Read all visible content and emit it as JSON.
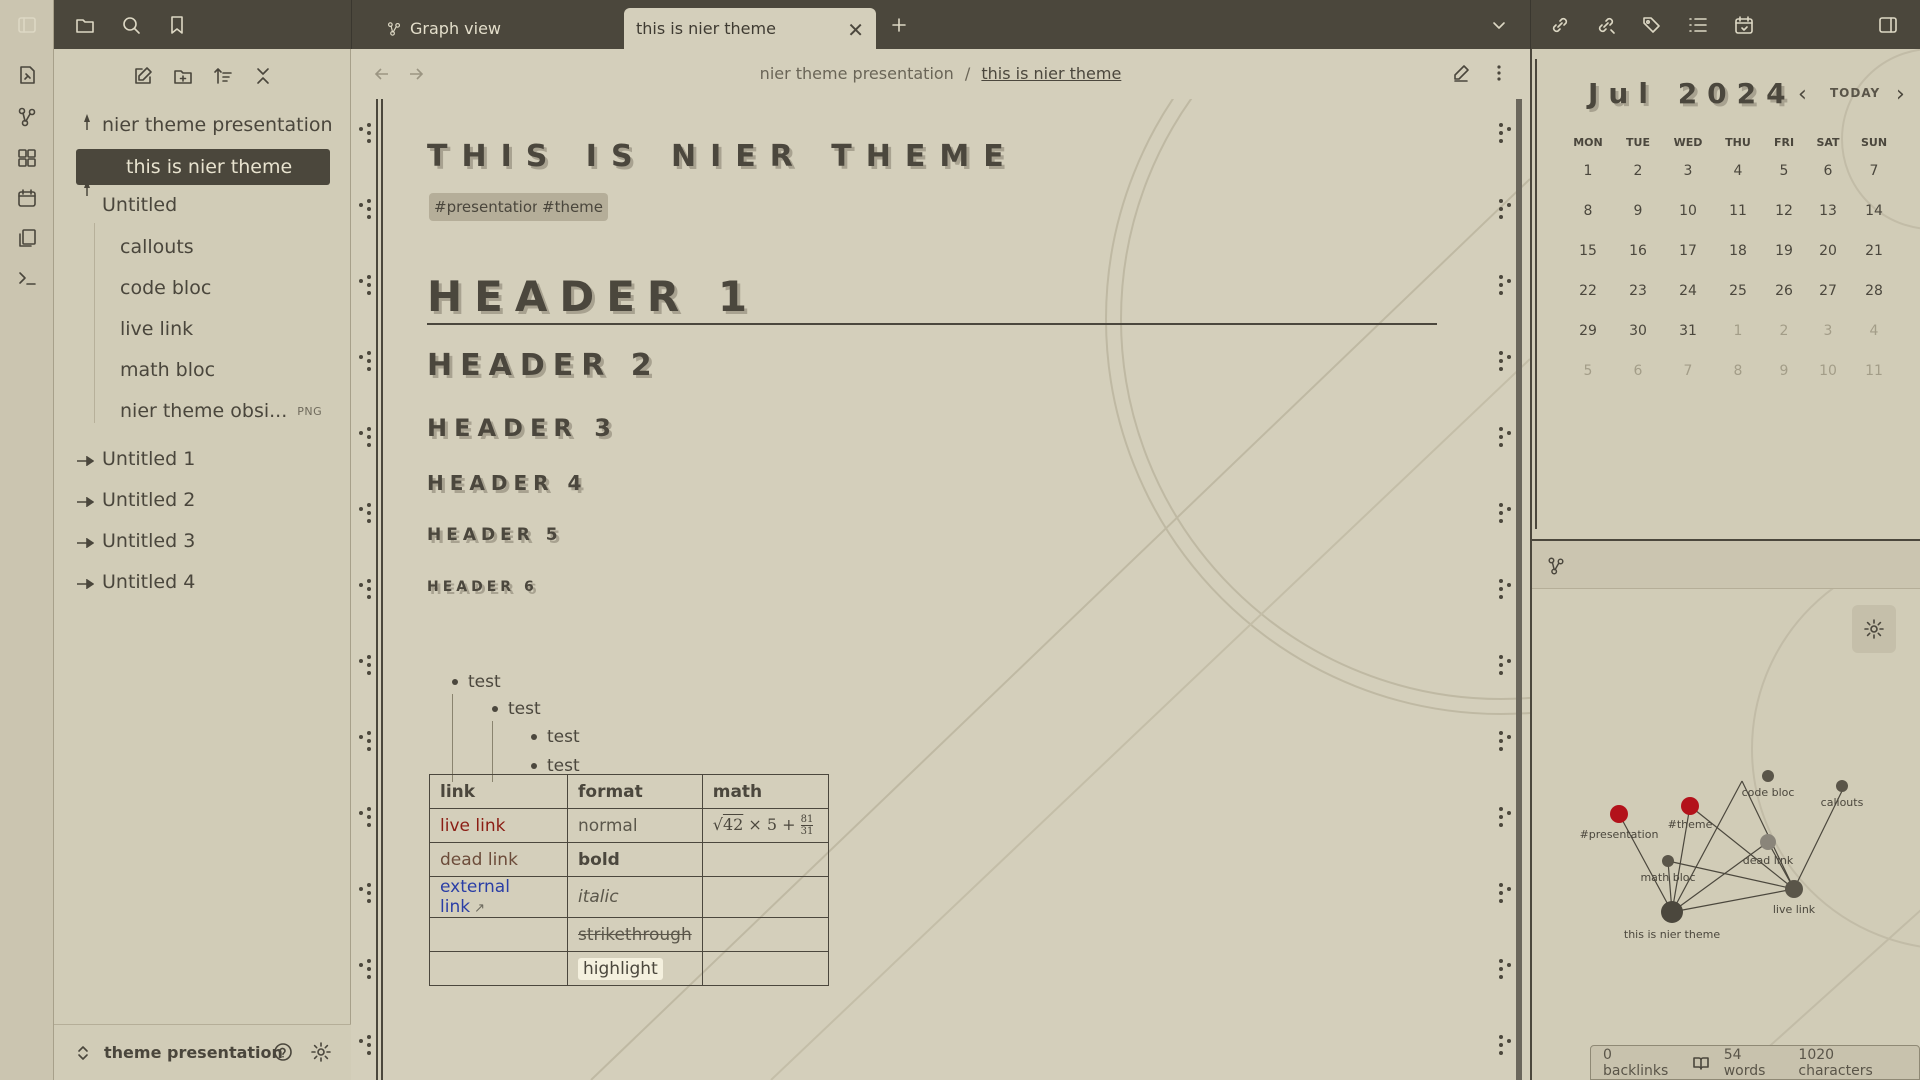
{
  "window": {
    "active_tab": "this is nier theme"
  },
  "tabs": [
    {
      "label": "Graph view"
    },
    {
      "label": "this is nier theme"
    }
  ],
  "breadcrumb": {
    "parent": "nier theme presentation",
    "separator": "/",
    "current": "this is nier theme"
  },
  "sidebar": {
    "root": "nier theme presentation",
    "active": "this is nier theme",
    "untitled": "Untitled",
    "children": [
      "callouts",
      "code bloc",
      "live link",
      "math bloc",
      "nier theme obsi..."
    ],
    "png_badge": "PNG",
    "others": [
      "Untitled 1",
      "Untitled 2",
      "Untitled 3",
      "Untitled 4"
    ],
    "vault": "theme presentation"
  },
  "doc": {
    "title": "THIS IS NIER THEME",
    "tags": [
      "#presentation",
      "#theme"
    ],
    "h1": "HEADER 1",
    "h2": "HEADER 2",
    "h3": "HEADER 3",
    "h4": "HEADER 4",
    "h5": "HEADER 5",
    "h6": "HEADER 6",
    "list": [
      "test",
      "test",
      "test",
      "test"
    ],
    "table": {
      "headers": [
        "link",
        "format",
        "math"
      ],
      "rows": [
        [
          "live link",
          "normal",
          "√42 × 5 + 81/31"
        ],
        [
          "dead link",
          "bold",
          ""
        ],
        [
          "external link",
          "italic",
          ""
        ],
        [
          "",
          "strikethrough",
          ""
        ],
        [
          "",
          "highlight",
          ""
        ]
      ]
    }
  },
  "calendar": {
    "month": "Jul",
    "year": "2024",
    "today_label": "TODAY",
    "weekdays": [
      "MON",
      "TUE",
      "WED",
      "THU",
      "FRI",
      "SAT",
      "SUN"
    ],
    "weeks": [
      [
        "1",
        "2",
        "3",
        "4",
        "5",
        "6",
        "7"
      ],
      [
        "8",
        "9",
        "10",
        "11",
        "12",
        "13",
        "14"
      ],
      [
        "15",
        "16",
        "17",
        "18",
        "19",
        "20",
        "21"
      ],
      [
        "22",
        "23",
        "24",
        "25",
        "26",
        "27",
        "28"
      ],
      [
        "29",
        "30",
        "31",
        "1",
        "2",
        "3",
        "4"
      ],
      [
        "5",
        "6",
        "7",
        "8",
        "9",
        "10",
        "11"
      ]
    ]
  },
  "graph": {
    "nodes": [
      "#presentation",
      "#theme",
      "code bloc",
      "callouts",
      "math bloc",
      "dead link",
      "live link",
      "this is nier theme"
    ]
  },
  "status": {
    "backlinks": "0 backlinks",
    "words": "54 words",
    "characters": "1020 characters"
  },
  "colors": {
    "accent": "#4b473c",
    "background": "#d4cfbb",
    "live_link": "#8b1d14",
    "external_link": "#2a3ea6",
    "tag_node": "#b3121b"
  }
}
